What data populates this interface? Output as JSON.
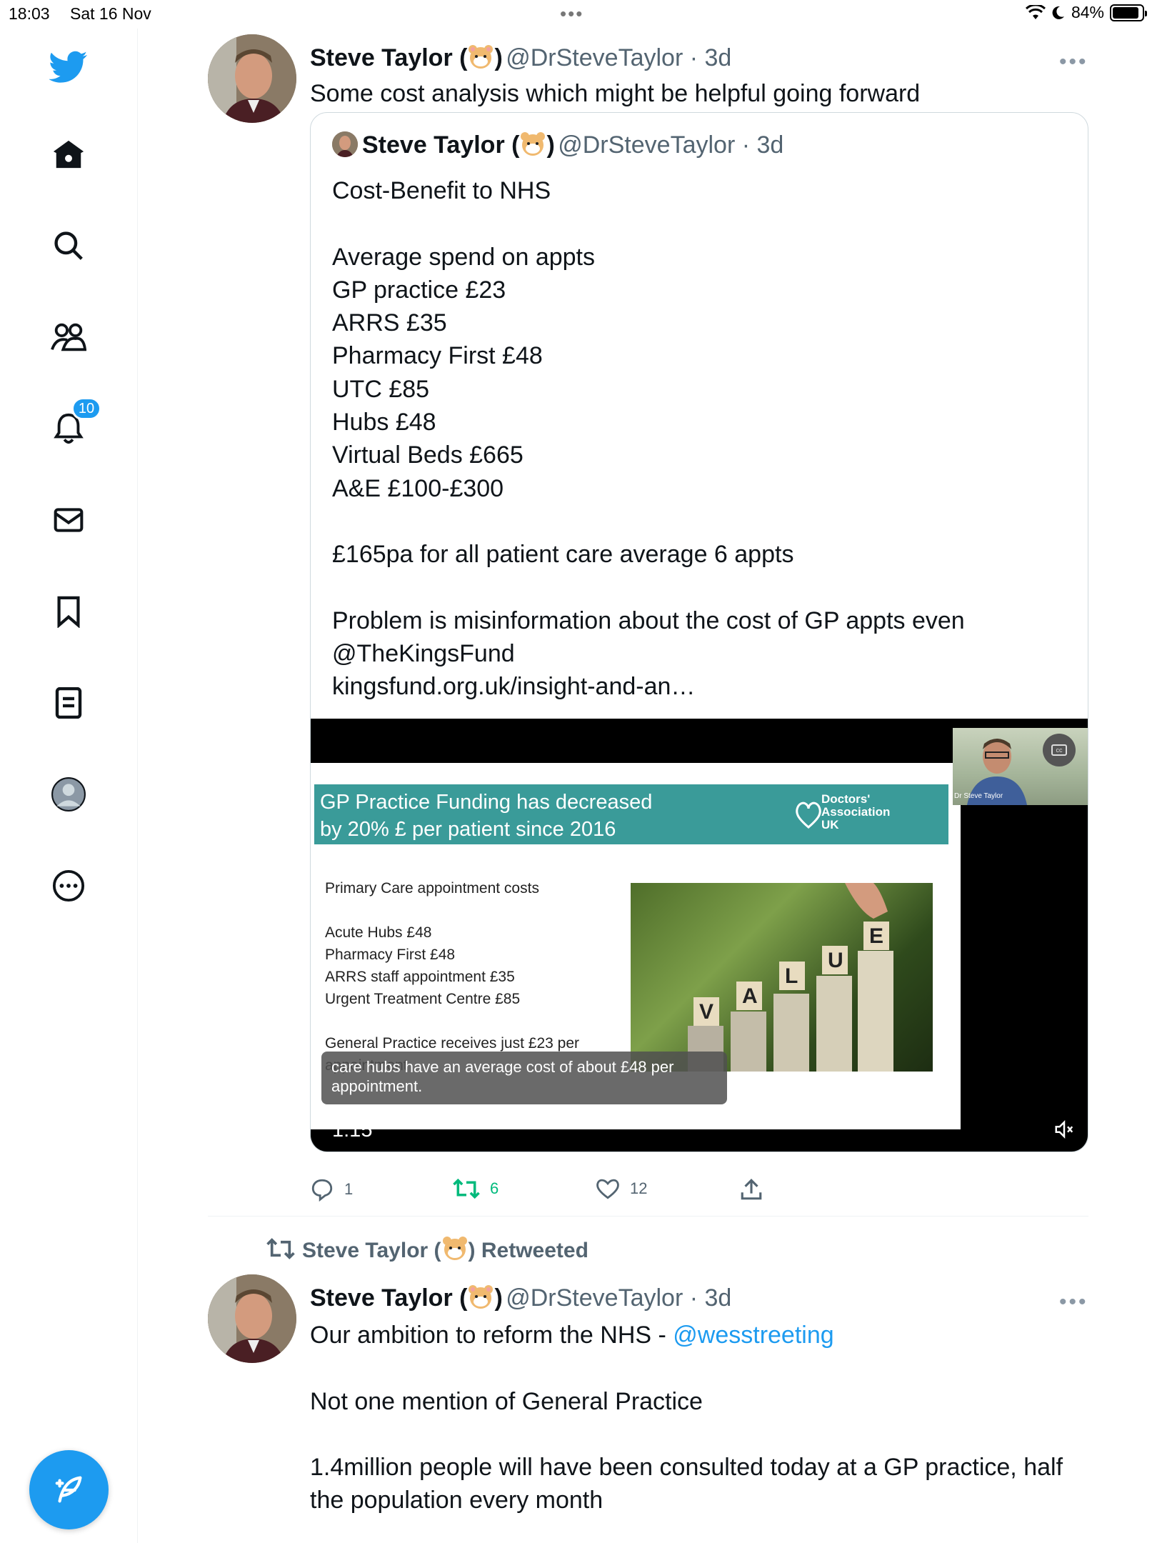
{
  "status_bar": {
    "time": "18:03",
    "date": "Sat 16 Nov",
    "battery": "84%"
  },
  "sidebar": {
    "notifications_count": "10"
  },
  "tweet1": {
    "name": "Steve Taylor (",
    "name_close": ")",
    "handle": "@DrSteveTaylor · 3d",
    "text": "Some cost analysis which might be helpful going forward",
    "quote": {
      "name": "Steve Taylor (",
      "name_close": ")",
      "handle": "@DrSteveTaylor · 3d",
      "body": "Cost-Benefit to NHS\n\nAverage spend on appts\nGP practice £23\nARRS £35\nPharmacy First £48\nUTC £85\nHubs £48\nVirtual Beds £665\nA&E £100-£300\n\n£165pa for all patient care average 6 appts\n\nProblem is misinformation about the cost of GP appts even\n@TheKingsFund\nkingsfund.org.uk/insight-and-an…",
      "video": {
        "slide_title": "GP Practice Funding has decreased\nby 20% £ per patient since 2016",
        "slide_logo": "Doctors'\nAssociation\nUK",
        "slide_text": "Primary Care appointment costs\n\nAcute Hubs £48\nPharmacy First £48\nARRS staff appointment £35\nUrgent Treatment Centre £85\n\nGeneral Practice receives just £23 per\nappointment",
        "image_letters": "VALUE",
        "pip_label": "Dr Steve Taylor",
        "caption": "care hubs have an average cost of about £48 per\nappointment.",
        "time": "1:15"
      }
    },
    "actions": {
      "replies": "1",
      "retweets": "6",
      "likes": "12"
    }
  },
  "tweet2": {
    "retweeted_by": "Steve Taylor (",
    "retweeted_close": ") Retweeted",
    "name": "Steve Taylor (",
    "name_close": ")",
    "handle": "@DrSteveTaylor · 3d",
    "line1_prefix": "Our ambition to reform the NHS - ",
    "line1_mention": "@wesstreeting",
    "para2": "Not one mention of General Practice",
    "para3": "1.4million people will have been consulted today at a GP practice, half the population every month"
  },
  "colors": {
    "accent": "#1d9bf0",
    "retweet_green": "#00ba7c",
    "slide_teal": "#3a9b99"
  },
  "icons": [
    "twitter-bird-icon",
    "home-icon",
    "search-icon",
    "communities-icon",
    "bell-icon",
    "mail-icon",
    "bookmark-icon",
    "lists-icon",
    "profile-icon",
    "more-circle-icon",
    "compose-icon",
    "reply-icon",
    "retweet-icon",
    "like-icon",
    "share-icon",
    "mute-icon",
    "wifi-icon",
    "moon-icon",
    "battery-icon"
  ]
}
